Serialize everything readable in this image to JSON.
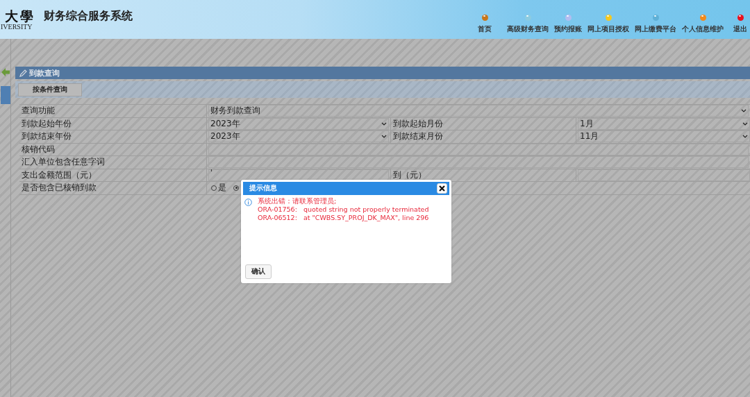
{
  "header": {
    "logo_text": "大學",
    "logo_subtext": "IVERSITY",
    "title": "财务综合服务系统",
    "nav": [
      {
        "label": "首页",
        "color": "#c8761a"
      },
      {
        "label": "高级财务查询",
        "color": "#8ccbe0"
      },
      {
        "label": "预约报账",
        "color": "#b3bdf0"
      },
      {
        "label": "网上项目授权",
        "color": "#f6c81e"
      },
      {
        "label": "网上缴费平台",
        "color": "#5fb0d6"
      },
      {
        "label": "个人信息维护",
        "color": "#f28a1a"
      },
      {
        "label": "退出",
        "color": "#e8101e"
      }
    ]
  },
  "panel": {
    "title": "到款查询",
    "toolbar_button": "按条件查询"
  },
  "form": {
    "rows": [
      {
        "kind": "select-wide",
        "label": "查询功能",
        "value": "财务到款查询"
      },
      {
        "kind": "select-pair",
        "label": "到款起始年份",
        "value": "2023年",
        "label2": "到款起始月份",
        "value2": "1月"
      },
      {
        "kind": "select-pair",
        "label": "到款结束年份",
        "value": "2023年",
        "label2": "到款结束月份",
        "value2": "11月"
      },
      {
        "kind": "input-wide",
        "label": "核销代码"
      },
      {
        "kind": "input-wide",
        "label": "汇入单位包含任意字词"
      },
      {
        "kind": "input-pair",
        "label": "支出金额范围（元）",
        "value": "'",
        "label2": "到（元）"
      },
      {
        "kind": "radio",
        "label": "是否包含已核销到款",
        "options": [
          {
            "label": "是",
            "selected": false
          },
          {
            "selected": true
          }
        ]
      }
    ]
  },
  "dialog": {
    "title": "提示信息",
    "lines": [
      "系统出错：请联系管理员;",
      "ORA-01756:   quoted string not properly terminated",
      "ORA-06512:   at \"CWBS.SY_PROJ_DK_MAX\", line 296"
    ],
    "button": "确认"
  }
}
